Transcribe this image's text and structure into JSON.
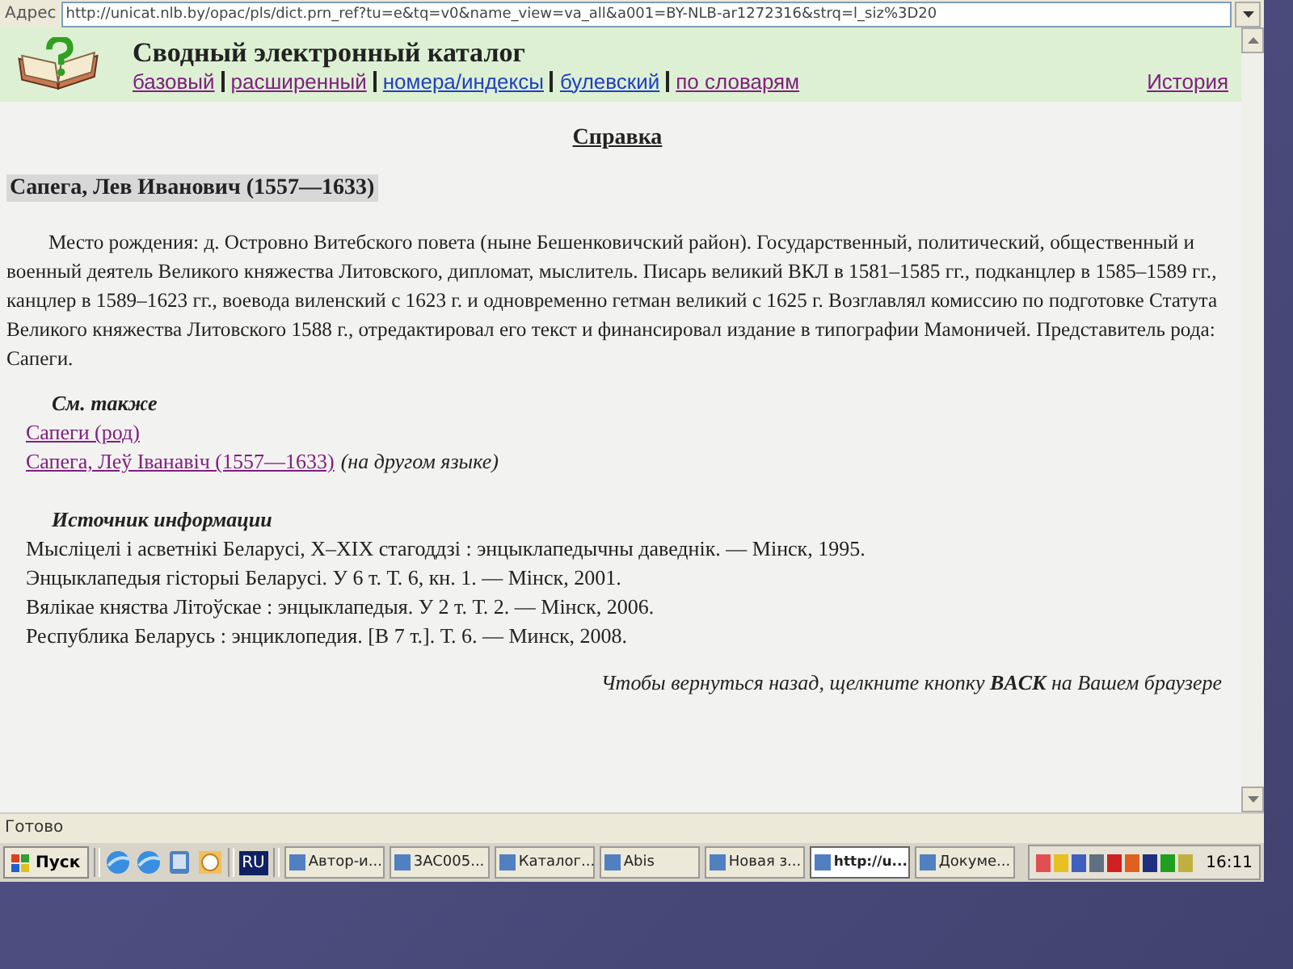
{
  "address_bar": {
    "label": "Адрес",
    "url": "http://unicat.nlb.by/opac/pls/dict.prn_ref?tu=e&tq=v0&name_view=va_all&a001=BY-NLB-ar1272316&strq=l_siz%3D20"
  },
  "header": {
    "title": "Сводный электронный каталог",
    "nav": [
      {
        "label": "базовый",
        "visited": true
      },
      {
        "label": "расширенный",
        "visited": true
      },
      {
        "label": "номера/индексы",
        "visited": false
      },
      {
        "label": "булевский",
        "visited": false
      },
      {
        "label": "по словарям",
        "visited": true
      }
    ],
    "history_link": {
      "label": "История",
      "visited": true
    }
  },
  "page": {
    "heading": "Справка",
    "person": "Сапега, Лев Иванович (1557—1633)",
    "biography": "Место рождения: д. Островно Витебского повета (ныне Бешенковичский район). Государственный, политический, общественный и военный деятель Великого княжества Литовского, дипломат, мыслитель. Писарь великий ВКЛ в 1581–1585 гг., подканцлер в 1585–1589 гг., канцлер в 1589–1623 гг., воевода виленский с 1623 г. и одновременно гетман великий с 1625 г. Возглавлял комиссию по подготовке Статута Великого княжества Литовского 1588 г., отредактировал его текст и финансировал издание в типографии Мамоничей. Представитель рода: Сапеги.",
    "see_also": {
      "heading": "См. также",
      "links": [
        {
          "label": "Сапеги (род)"
        },
        {
          "label": "Сапега, Леў Іванавіч (1557—1633)",
          "note": "(на другом языке)"
        }
      ]
    },
    "sources": {
      "heading": "Источник информации",
      "items": [
        "Мысліцелі і асветнікі Беларусі, X–XIX стагоддзі : энцыклапедычны даведнік. — Мінск, 1995.",
        "Энцыклапедыя гісторыі Беларусі. У 6 т. Т. 6, кн. 1. — Мінск, 2001.",
        "Вялікае княства Літоўскае : энцыклапедыя. У 2 т. Т. 2. — Мінск, 2006.",
        "Республика Беларусь : энциклопедия. [В 7 т.]. Т. 6. — Минск, 2008."
      ]
    },
    "back_note": "Чтобы вернуться назад, щелкните кнопку **BACK** на Вашем браузере"
  },
  "status_bar": "Готово",
  "taskbar": {
    "start": "Пуск",
    "language": "RU",
    "tasks": [
      {
        "label": "Автор-и...",
        "selected": false
      },
      {
        "label": "3AC005...",
        "selected": false
      },
      {
        "label": "Каталог...",
        "selected": false
      },
      {
        "label": "Abis",
        "selected": false
      },
      {
        "label": "Новая з...",
        "selected": false
      },
      {
        "label": "http://u...",
        "selected": true
      },
      {
        "label": "Докуме...",
        "selected": false
      }
    ],
    "clock": "16:11"
  }
}
